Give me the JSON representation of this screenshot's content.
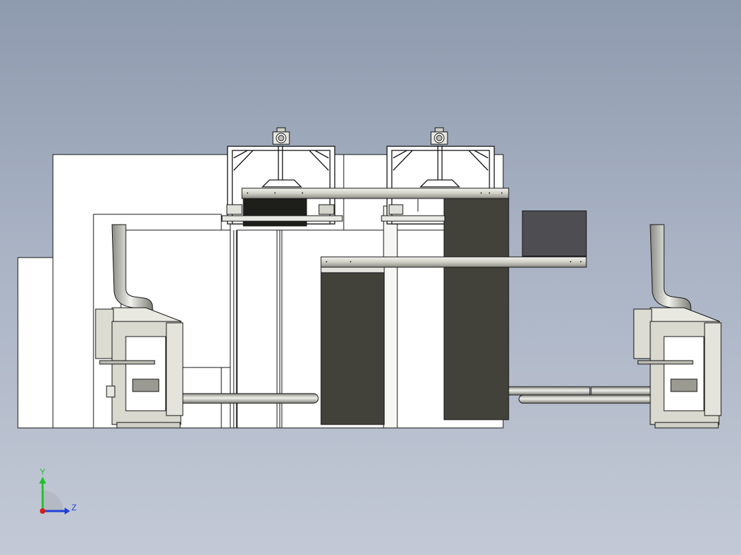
{
  "viewport": {
    "background_top": "#8e9aae",
    "background_bottom": "#c3c9d6"
  },
  "triad": {
    "y_label": "Y",
    "z_label": "Z",
    "y_color": "#21c12a",
    "z_color": "#1f3fd6",
    "x_color": "#d11f1f"
  },
  "palette": {
    "line": "#111111",
    "face": "#ffffff",
    "frame": "#d9d9cf",
    "dark_panel": "#42413a",
    "black_panel": "#1e1e1a",
    "grey_box": "#4d4d52",
    "steel": "#c9c9c1"
  }
}
